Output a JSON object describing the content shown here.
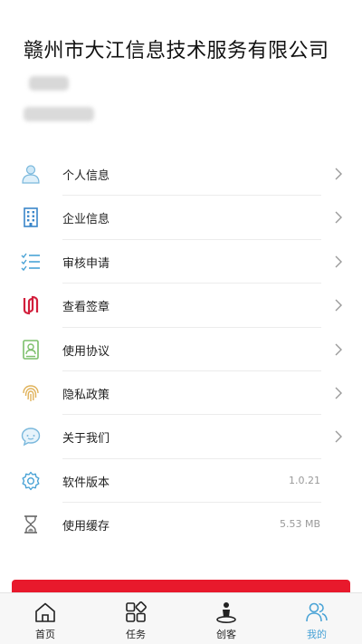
{
  "header": {
    "company_name": "赣州市大江信息技术服务有限公司"
  },
  "menu": {
    "items": [
      {
        "label": "个人信息",
        "icon": "person-icon"
      },
      {
        "label": "企业信息",
        "icon": "building-icon"
      },
      {
        "label": "审核申请",
        "icon": "checklist-icon"
      },
      {
        "label": "查看签章",
        "icon": "seal-icon"
      },
      {
        "label": "使用协议",
        "icon": "agreement-icon"
      },
      {
        "label": "隐私政策",
        "icon": "fingerprint-icon"
      },
      {
        "label": "关于我们",
        "icon": "chat-icon"
      },
      {
        "label": "软件版本",
        "icon": "gear-icon",
        "value": "1.0.21"
      },
      {
        "label": "使用缓存",
        "icon": "hourglass-icon",
        "value": "5.53 MB"
      }
    ]
  },
  "tabbar": {
    "tabs": [
      {
        "label": "首页",
        "icon": "home-icon"
      },
      {
        "label": "任务",
        "icon": "grid-icon"
      },
      {
        "label": "创客",
        "icon": "maker-icon"
      },
      {
        "label": "我的",
        "icon": "users-icon",
        "active": true
      }
    ]
  },
  "colors": {
    "accent": "#4aa3d6",
    "red": "#e8192c",
    "blue": "#3a86c9",
    "green": "#7cbf6a",
    "gold": "#e0b25a"
  }
}
